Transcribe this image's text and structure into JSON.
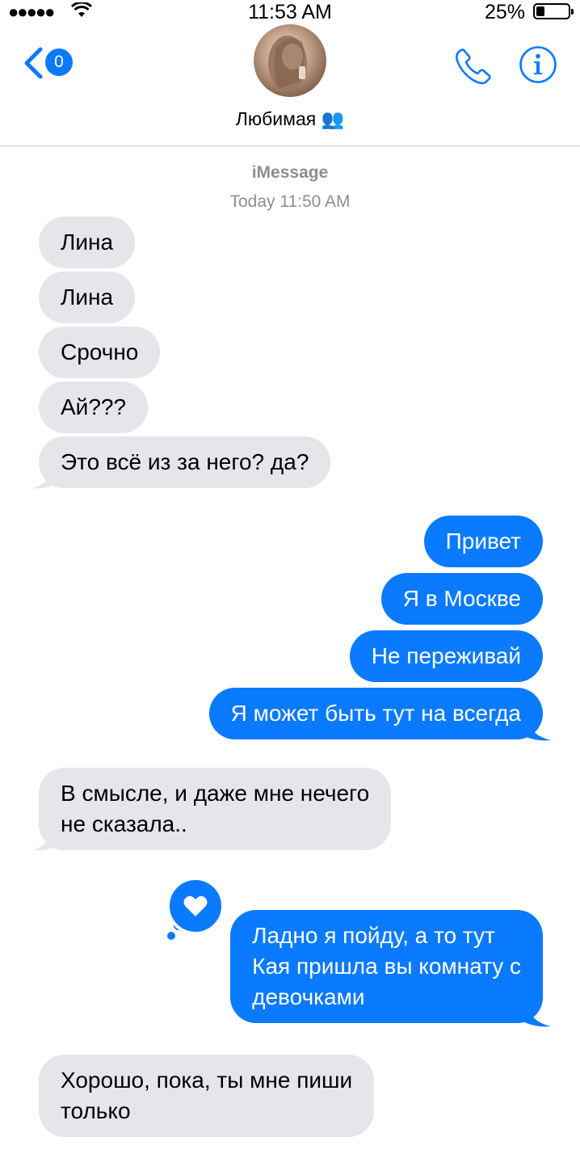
{
  "status_bar": {
    "signal": "●●●●●",
    "time": "11:53 AM",
    "battery_percent": "25%",
    "battery_level": 0.25
  },
  "header": {
    "back_badge": "0",
    "contact_name": "Любимая 👥",
    "icons": [
      "back-chevron-icon",
      "phone-icon",
      "info-icon"
    ]
  },
  "conversation": {
    "service": "iMessage",
    "timestamp": "Today 11:50 AM",
    "messages": [
      {
        "from": "them",
        "text": "Лина"
      },
      {
        "from": "them",
        "text": "Лина"
      },
      {
        "from": "them",
        "text": "Срочно"
      },
      {
        "from": "them",
        "text": "Ай???"
      },
      {
        "from": "them",
        "text": "Это всё из за него? да?"
      },
      {
        "from": "me",
        "text": "Привет"
      },
      {
        "from": "me",
        "text": "Я в Москве"
      },
      {
        "from": "me",
        "text": "Не переживай"
      },
      {
        "from": "me",
        "text": "Я может быть тут на всегда"
      },
      {
        "from": "them",
        "lines": [
          "В смысле, и даже мне нечего",
          "не сказала.."
        ]
      },
      {
        "from": "me",
        "lines": [
          "Ладно я пойду, а то тут",
          "Кая пришла вы комнату с",
          "девочками"
        ],
        "reaction": "heart-icon"
      },
      {
        "from": "them",
        "lines": [
          "Хорошо, пока, ты мне пиши",
          "только"
        ]
      }
    ]
  },
  "colors": {
    "accent": "#0a7aff",
    "incoming_bubble": "#e5e5ea",
    "meta_text": "#8e8e93"
  }
}
